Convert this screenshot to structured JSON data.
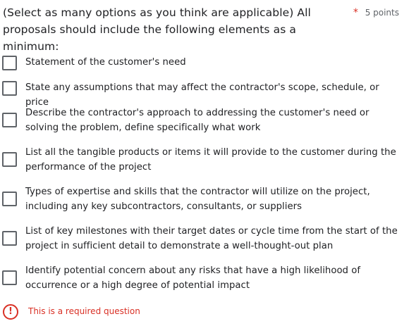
{
  "question": {
    "text": "(Select as many options as you think are applicable) All proposals should include the following elements as a minimum:",
    "required_star": "*",
    "points": "5 points"
  },
  "options": [
    {
      "label": "Statement of the customer's need",
      "checked": false
    },
    {
      "label": "State any assumptions that may affect the contractor's scope, schedule, or price",
      "checked": false
    },
    {
      "label": "Describe the contractor's approach to addressing the customer's need or solving the problem, define specifically what work",
      "checked": false
    },
    {
      "label": "List all the tangible products or items it will provide to the customer during the performance of the project",
      "checked": false
    },
    {
      "label": "Types of expertise and skills that the contractor will utilize on the project, including any key subcontractors, consultants, or suppliers",
      "checked": false
    },
    {
      "label": "List of key milestones with their target dates or cycle time from the start of the project in sufficient detail to demonstrate a well-thought-out plan",
      "checked": false
    },
    {
      "label": "Identify potential concern about any risks that have a high likelihood of occurrence or a high degree of potential impact",
      "checked": false
    }
  ],
  "validation": {
    "icon": "error-icon",
    "icon_glyph": "!",
    "message": "This is a required question",
    "color": "#d93025"
  }
}
